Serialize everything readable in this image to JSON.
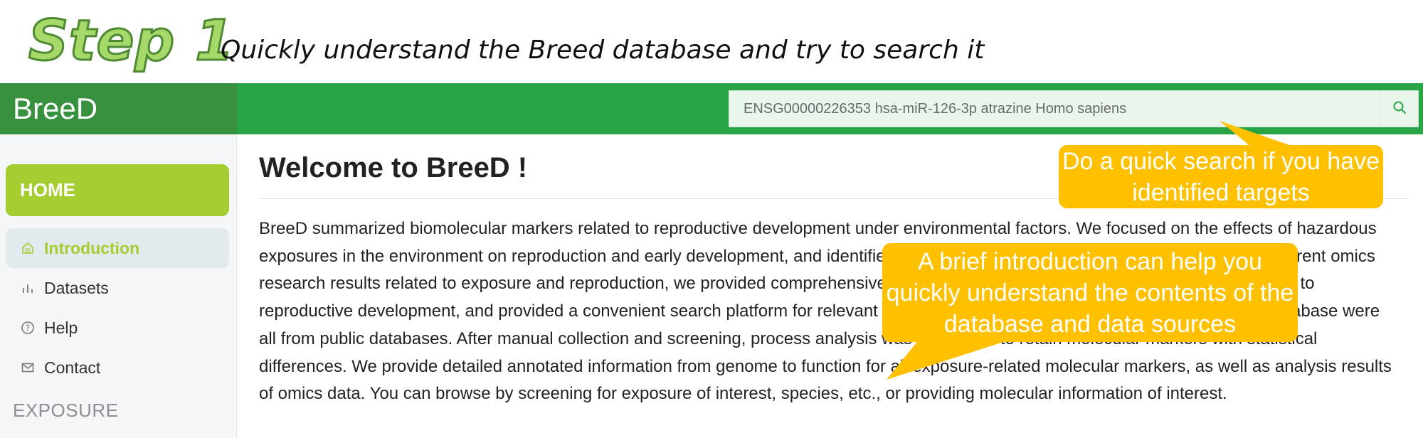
{
  "step": {
    "title": "Step 1",
    "subtitle": "Quickly understand the Breed database and try to search it"
  },
  "header": {
    "brand": "BreeD",
    "search_placeholder": "ENSG00000226353 hsa-miR-126-3p atrazine Homo sapiens",
    "search_icon": "search-icon"
  },
  "sidebar": {
    "home_label": "HOME",
    "items": [
      {
        "label": "Introduction",
        "icon": "home-icon",
        "active": true
      },
      {
        "label": "Datasets",
        "icon": "bar-chart-icon"
      },
      {
        "label": "Help",
        "icon": "question-icon"
      },
      {
        "label": "Contact",
        "icon": "mail-icon"
      }
    ],
    "section": "EXPOSURE"
  },
  "main": {
    "title": "Welcome to BreeD !",
    "intro": "BreeD summarized biomolecular markers related to reproductive development under environmental factors. We focused on the effects of hazardous exposures in the environment on reproduction and early development, and identified the related molecular markers. By integrating the current omics research results related to exposure and reproduction, we provided comprehensive molecular information on the interference of exposure to reproductive development, and provided a convenient search platform for relevant researchers. The multi-omics data analyzed in this database were all from public databases. After manual collection and screening, process analysis was conducted to retain molecular markers with statistical differences. We provide detailed annotated information from genome to function for all exposure-related molecular markers, as well as analysis results of omics data. You can browse by screening for exposure of interest, species, etc., or providing molecular information of interest."
  },
  "callouts": {
    "search": "Do a quick search if you have identified targets",
    "intro": "A brief introduction can help you quickly understand the contents of the database and data sources"
  },
  "colors": {
    "topbar": "#29a446",
    "brand_bg": "#38913f",
    "home_btn": "#a4cd2f",
    "callout": "#ffc000"
  }
}
